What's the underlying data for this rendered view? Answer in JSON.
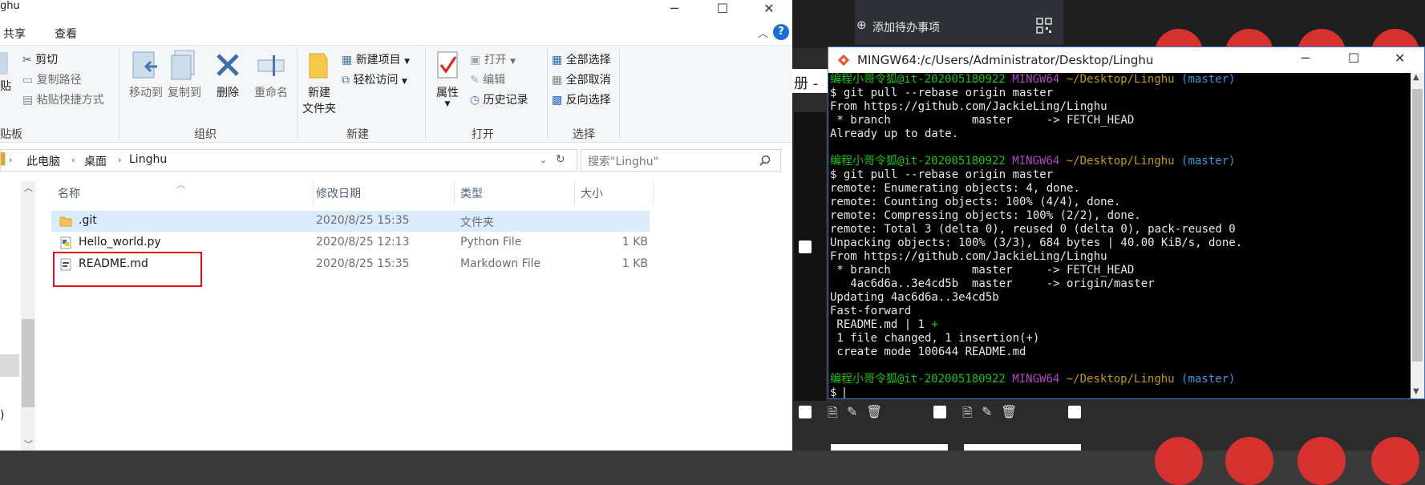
{
  "explorer": {
    "title_fragment": "ghu",
    "tabs": [
      "共享",
      "查看"
    ],
    "ribbon": {
      "clipboard": {
        "paste_fragment": "贴",
        "cut": "剪切",
        "copy_path": "复制路径",
        "paste_shortcut": "粘贴快捷方式",
        "group_fragment": "贴板"
      },
      "organize": {
        "move_to": "移动到",
        "copy_to": "复制到",
        "delete": "删除",
        "rename": "重命名",
        "group": "组织"
      },
      "new": {
        "new_folder_line1": "新建",
        "new_folder_line2": "文件夹",
        "new_item": "新建项目",
        "easy_access": "轻松访问",
        "group": "新建"
      },
      "open": {
        "properties": "属性",
        "open": "打开",
        "edit": "编辑",
        "history": "历史记录",
        "group": "打开"
      },
      "select": {
        "select_all": "全部选择",
        "select_none": "全部取消",
        "invert": "反向选择",
        "group": "选择"
      }
    },
    "breadcrumb": [
      "此电脑",
      "桌面",
      "Linghu"
    ],
    "search_placeholder": "搜索\"Linghu\"",
    "columns": [
      "名称",
      "修改日期",
      "类型",
      "大小"
    ],
    "files": [
      {
        "name": ".git",
        "date": "2020/8/25 15:35",
        "type": "文件夹",
        "size": ""
      },
      {
        "name": "Hello_world.py",
        "date": "2020/8/25 12:13",
        "type": "Python File",
        "size": "1 KB"
      },
      {
        "name": "README.md",
        "date": "2020/8/25 15:35",
        "type": "Markdown File",
        "size": "1 KB"
      }
    ],
    "nav_fragment": ")"
  },
  "background": {
    "todo_label": "添加待办事项",
    "side_fragment": "册 -"
  },
  "terminal": {
    "title": "MINGW64:/c/Users/Administrator/Desktop/Linghu",
    "lines": [
      {
        "prompt": true,
        "user": "编程小哥令狐@it-202005180922",
        "env": "MINGW64",
        "path": "~/Desktop/Linghu",
        "branch": "(master)"
      },
      {
        "text": "$ git pull --rebase origin master"
      },
      {
        "text": "From https://github.com/JackieLing/Linghu"
      },
      {
        "text": " * branch            master     -> FETCH_HEAD"
      },
      {
        "text": "Already up to date."
      },
      {
        "text": ""
      },
      {
        "prompt": true,
        "user": "编程小哥令狐@it-202005180922",
        "env": "MINGW64",
        "path": "~/Desktop/Linghu",
        "branch": "(master)"
      },
      {
        "text": "$ git pull --rebase origin master"
      },
      {
        "text": "remote: Enumerating objects: 4, done."
      },
      {
        "text": "remote: Counting objects: 100% (4/4), done."
      },
      {
        "text": "remote: Compressing objects: 100% (2/2), done."
      },
      {
        "text": "remote: Total 3 (delta 0), reused 0 (delta 0), pack-reused 0"
      },
      {
        "text": "Unpacking objects: 100% (3/3), 684 bytes | 40.00 KiB/s, done."
      },
      {
        "text": "From https://github.com/JackieLing/Linghu"
      },
      {
        "text": " * branch            master     -> FETCH_HEAD"
      },
      {
        "text": "   4ac6d6a..3e4cd5b  master     -> origin/master"
      },
      {
        "text": "Updating 4ac6d6a..3e4cd5b"
      },
      {
        "text": "Fast-forward"
      },
      {
        "diff": true,
        "text": " README.md | 1 ",
        "plus": "+"
      },
      {
        "text": " 1 file changed, 1 insertion(+)"
      },
      {
        "text": " create mode 100644 README.md"
      },
      {
        "text": ""
      },
      {
        "prompt": true,
        "user": "编程小哥令狐@it-202005180922",
        "env": "MINGW64",
        "path": "~/Desktop/Linghu",
        "branch": "(master)"
      },
      {
        "text": "$ "
      }
    ]
  },
  "colors": {
    "prompt_user": "#16c60c",
    "prompt_env": "#b148c6",
    "prompt_path": "#c19c00",
    "prompt_branch": "#3a96dd",
    "highlight_box": "#e0101a"
  },
  "icons": [
    "close-icon",
    "maximize-icon",
    "minimize-icon",
    "help-icon",
    "scissors-icon",
    "folder-icon",
    "refresh-icon",
    "search-icon",
    "python-file-icon",
    "markdown-file-icon",
    "git-icon"
  ]
}
